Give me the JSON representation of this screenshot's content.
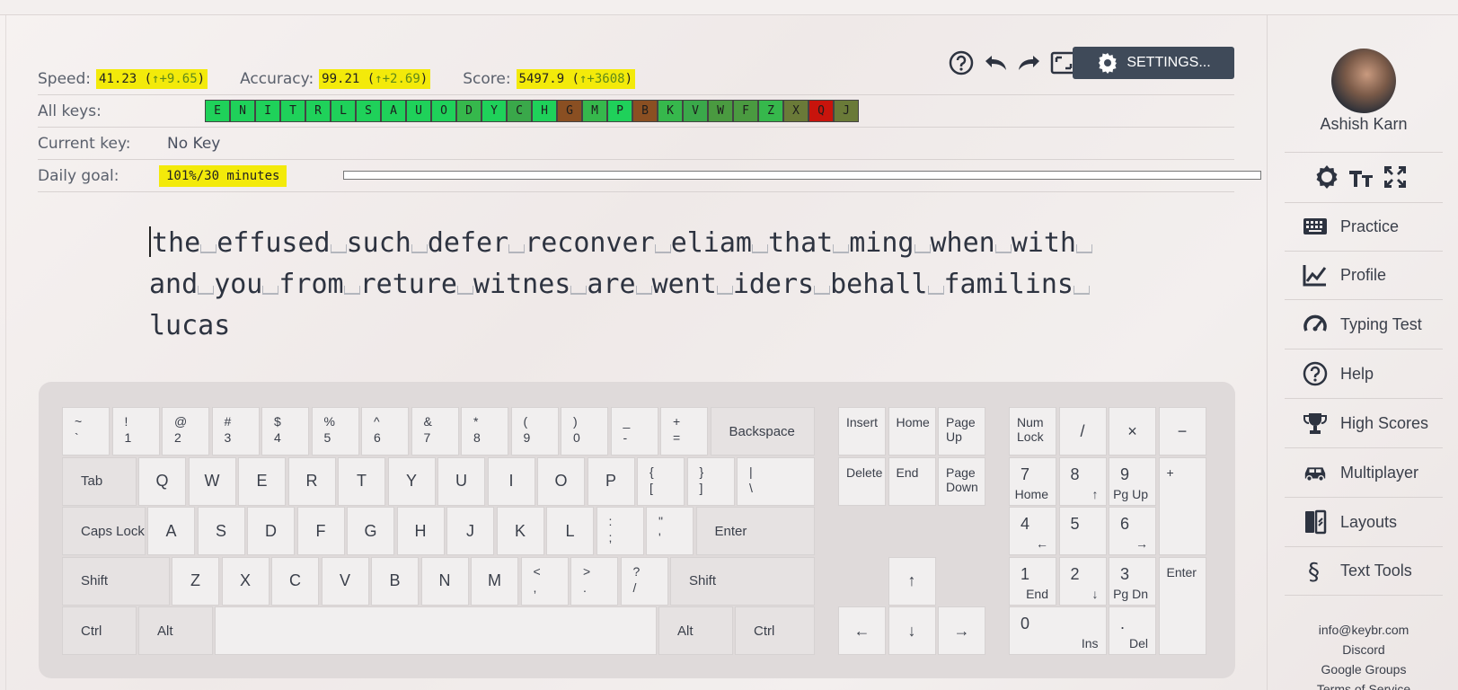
{
  "stats": {
    "speed_label": "Speed:",
    "speed_value": "41.23 (",
    "speed_delta": "↑+9.65",
    "speed_close": ")",
    "accuracy_label": "Accuracy:",
    "accuracy_value": "99.21 (",
    "accuracy_delta": "↑+2.69",
    "accuracy_close": ")",
    "score_label": "Score:",
    "score_value": "5497.9 (",
    "score_delta": "↑+3608",
    "score_close": ")",
    "all_keys_label": "All keys:",
    "current_key_label": "Current key:",
    "current_key_value": "No Key",
    "daily_goal_label": "Daily goal:",
    "daily_goal_value": "101%/30 minutes",
    "daily_goal_progress": 1.0
  },
  "all_keys": [
    {
      "k": "E",
      "color": "#1fd15a"
    },
    {
      "k": "N",
      "color": "#1fd15a"
    },
    {
      "k": "I",
      "color": "#1fd15a"
    },
    {
      "k": "T",
      "color": "#1fd15a"
    },
    {
      "k": "R",
      "color": "#1fd15a"
    },
    {
      "k": "L",
      "color": "#1fd15a"
    },
    {
      "k": "S",
      "color": "#1fd15a"
    },
    {
      "k": "A",
      "color": "#1fd15a"
    },
    {
      "k": "U",
      "color": "#1fd15a"
    },
    {
      "k": "O",
      "color": "#1fd15a"
    },
    {
      "k": "D",
      "color": "#36b84c"
    },
    {
      "k": "Y",
      "color": "#1fd15a"
    },
    {
      "k": "C",
      "color": "#3aa84a"
    },
    {
      "k": "H",
      "color": "#1fd15a"
    },
    {
      "k": "G",
      "color": "#8a4f22"
    },
    {
      "k": "M",
      "color": "#36b84c"
    },
    {
      "k": "P",
      "color": "#1fd15a"
    },
    {
      "k": "B",
      "color": "#8a4f22"
    },
    {
      "k": "K",
      "color": "#36b84c"
    },
    {
      "k": "V",
      "color": "#3aa84a"
    },
    {
      "k": "W",
      "color": "#4a9a40"
    },
    {
      "k": "F",
      "color": "#4a9a40"
    },
    {
      "k": "Z",
      "color": "#36b84c"
    },
    {
      "k": "X",
      "color": "#6a7a38"
    },
    {
      "k": "Q",
      "color": "#c8140c"
    },
    {
      "k": "J",
      "color": "#6a7a38"
    }
  ],
  "header": {
    "settings_label": "SETTINGS..."
  },
  "typing_text": {
    "lines": [
      [
        "the",
        "effused",
        "such",
        "defer",
        "reconver",
        "eliam",
        "that",
        "ming",
        "when",
        "with",
        ""
      ],
      [
        "and",
        "you",
        "from",
        "reture",
        "witnes",
        "are",
        "went",
        "iders",
        "behall",
        "familins",
        ""
      ],
      [
        "lucas"
      ]
    ]
  },
  "keyboard": {
    "row1": [
      {
        "t": "~",
        "b": "`"
      },
      {
        "t": "!",
        "b": "1"
      },
      {
        "t": "@",
        "b": "2"
      },
      {
        "t": "#",
        "b": "3"
      },
      {
        "t": "$",
        "b": "4"
      },
      {
        "t": "%",
        "b": "5"
      },
      {
        "t": "^",
        "b": "6"
      },
      {
        "t": "&",
        "b": "7"
      },
      {
        "t": "*",
        "b": "8"
      },
      {
        "t": "(",
        "b": "9"
      },
      {
        "t": ")",
        "b": "0"
      },
      {
        "t": "_",
        "b": "-"
      },
      {
        "t": "+",
        "b": "="
      }
    ],
    "backspace": "Backspace",
    "tab": "Tab",
    "row2": [
      "Q",
      "W",
      "E",
      "R",
      "T",
      "Y",
      "U",
      "I",
      "O",
      "P"
    ],
    "row2_sym": [
      {
        "t": "{",
        "b": "["
      },
      {
        "t": "}",
        "b": "]"
      },
      {
        "t": "|",
        "b": "\\"
      }
    ],
    "caps": "Caps Lock",
    "row3": [
      "A",
      "S",
      "D",
      "F",
      "G",
      "H",
      "J",
      "K",
      "L"
    ],
    "row3_sym": [
      {
        "t": ":",
        "b": ";"
      },
      {
        "t": "\"",
        "b": "'"
      }
    ],
    "enter": "Enter",
    "shift": "Shift",
    "row4": [
      "Z",
      "X",
      "C",
      "V",
      "B",
      "N",
      "M"
    ],
    "row4_sym": [
      {
        "t": "<",
        "b": ","
      },
      {
        "t": ">",
        "b": "."
      },
      {
        "t": "?",
        "b": "/"
      }
    ],
    "ctrl": "Ctrl",
    "alt": "Alt",
    "nav_keys": {
      "insert": "Insert",
      "home": "Home",
      "page_up": "Page Up",
      "delete": "Delete",
      "end": "End",
      "page_down": "Page Down"
    },
    "arrows": {
      "up": "↑",
      "left": "←",
      "down": "↓",
      "right": "→"
    },
    "numpad": {
      "numlock": "Num Lock",
      "div": "/",
      "mul": "×",
      "minus": "−",
      "plus": "+",
      "enter": "Enter",
      "n7": "7",
      "n7s": "Home",
      "n8": "8",
      "n8s": "↑",
      "n9": "9",
      "n9s": "Pg Up",
      "n4": "4",
      "n4s": "←",
      "n5": "5",
      "n6": "6",
      "n6s": "→",
      "n1": "1",
      "n1s": "End",
      "n2": "2",
      "n2s": "↓",
      "n3": "3",
      "n3s": "Pg Dn",
      "n0": "0",
      "n0s": "Ins",
      "dot": ".",
      "dots": "Del"
    }
  },
  "sidebar": {
    "user_name": "Ashish Karn",
    "nav": [
      {
        "label": "Practice",
        "icon": "keyboard-icon"
      },
      {
        "label": "Profile",
        "icon": "chart-icon"
      },
      {
        "label": "Typing Test",
        "icon": "speedometer-icon"
      },
      {
        "label": "Help",
        "icon": "help-icon"
      },
      {
        "label": "High Scores",
        "icon": "trophy-icon"
      },
      {
        "label": "Multiplayer",
        "icon": "car-icon"
      },
      {
        "label": "Layouts",
        "icon": "layouts-icon"
      },
      {
        "label": "Text Tools",
        "icon": "section-icon"
      }
    ],
    "footer": [
      "info@keybr.com",
      "Discord",
      "Google Groups",
      "Terms of Service"
    ]
  }
}
